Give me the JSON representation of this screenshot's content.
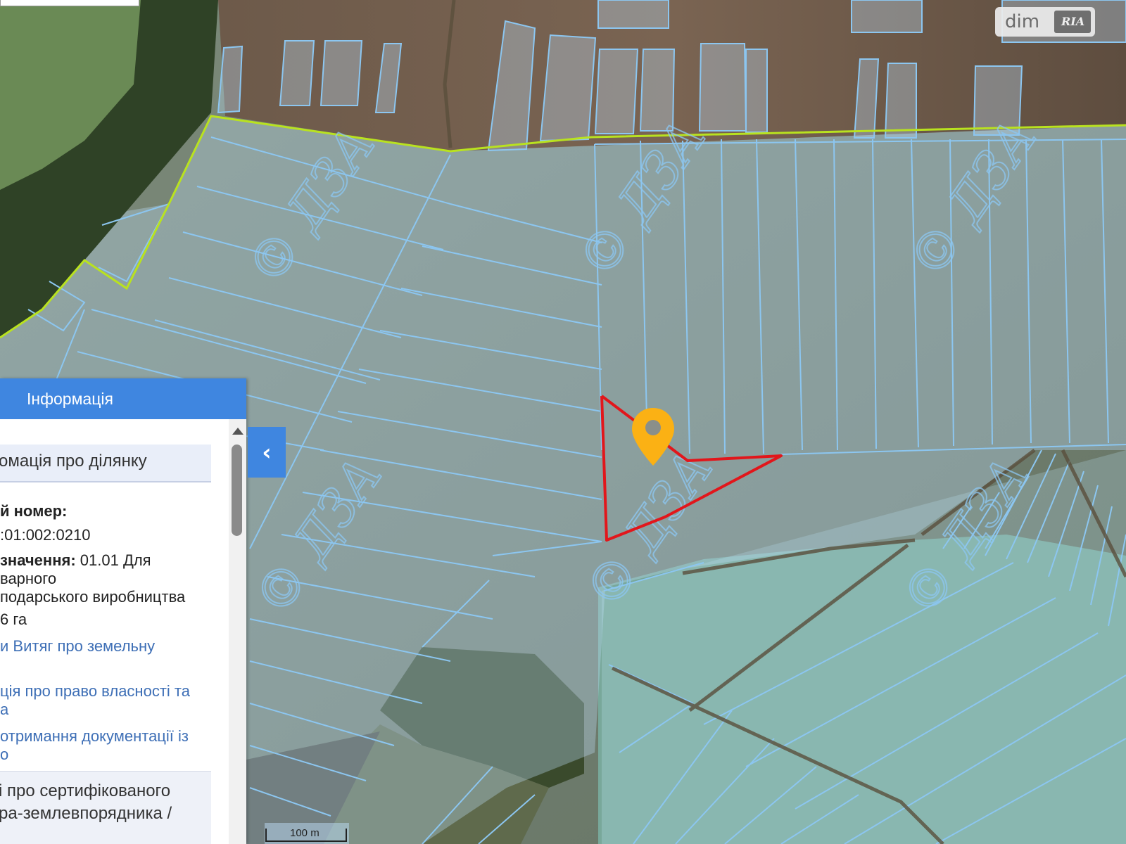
{
  "colors": {
    "parcel_outline": "#8cc6f0",
    "parcel_fill": "#bcdcf5",
    "boundary_line": "#b9e21f",
    "selected_parcel": "#e2161b",
    "marker": "#fbb114",
    "panel_header": "#3f86e0",
    "link": "#3e6fb6"
  },
  "icons": {
    "marker": "map-pin-icon",
    "toggle": "chevron-left-icon",
    "scroll_up": "triangle-up-icon"
  },
  "watermark": {
    "text": "© ДЗА"
  },
  "logo": {
    "text": "dim",
    "mark": "RIA"
  },
  "scale": {
    "label": "100 m"
  },
  "info_panel": {
    "title": "Інформація",
    "section_title": "омація про ділянку",
    "cadastral_label": "й номер:",
    "cadastral_value": ":01:002:0210",
    "purpose_label": "значення:",
    "purpose_value": " 01.01 Для",
    "purpose_line2": "варного",
    "purpose_line3": "подарського виробництва",
    "area": "6 га",
    "link_extract": "и Витяг про земельну",
    "link_rights_1": "ція про право власності та",
    "link_rights_2": "а",
    "link_docs_1": "отримання документації із",
    "link_docs_2": "о",
    "surveyor_line1": "і про сертифікованого",
    "surveyor_line2": "ра-землевпорядника /"
  }
}
